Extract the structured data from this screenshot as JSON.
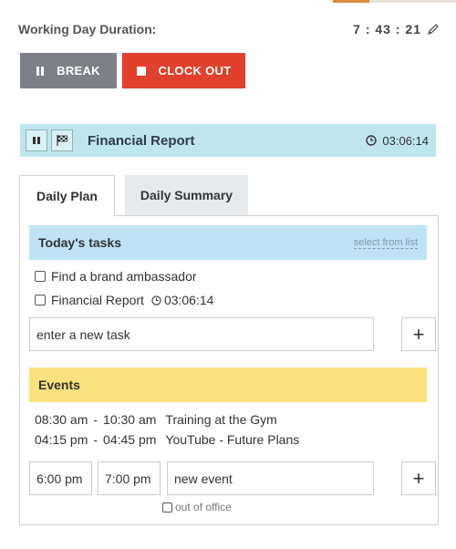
{
  "header": {
    "duration_label": "Working Day Duration:",
    "duration_value": "7 : 43 : 21",
    "edit_icon": "pencil-icon"
  },
  "actions": {
    "break_label": "BREAK",
    "clock_out_label": "CLOCK OUT",
    "break_color": "#7d8187",
    "clock_out_color": "#e1402c"
  },
  "current_task": {
    "title": "Financial Report",
    "elapsed": "03:06:14",
    "pause_icon": "pause-icon",
    "flag_icon": "flag-icon",
    "clock_icon": "clock-icon",
    "bar_color": "#bfe6ed"
  },
  "tabs": [
    {
      "label": "Daily Plan",
      "active": true
    },
    {
      "label": "Daily Summary",
      "active": false
    }
  ],
  "tasks_section": {
    "title": "Today's tasks",
    "select_link": "select from list",
    "items": [
      {
        "label": "Find a brand ambassador",
        "checked": false
      },
      {
        "label": "Financial Report",
        "time": "03:06:14",
        "checked": false
      }
    ],
    "new_task_placeholder": "enter a new task",
    "add_label": "+"
  },
  "events_section": {
    "title": "Events",
    "items": [
      {
        "start": "08:30 am",
        "sep": "-",
        "end": "10:30 am",
        "title": "Training at the Gym"
      },
      {
        "start": "04:15 pm",
        "sep": "-",
        "end": "04:45 pm",
        "title": "YouTube - Future Plans"
      }
    ],
    "new_event_start": "6:00 pm",
    "new_event_end": "7:00 pm",
    "new_event_placeholder": "new event",
    "out_of_office_label": "out of office",
    "add_label": "+"
  }
}
